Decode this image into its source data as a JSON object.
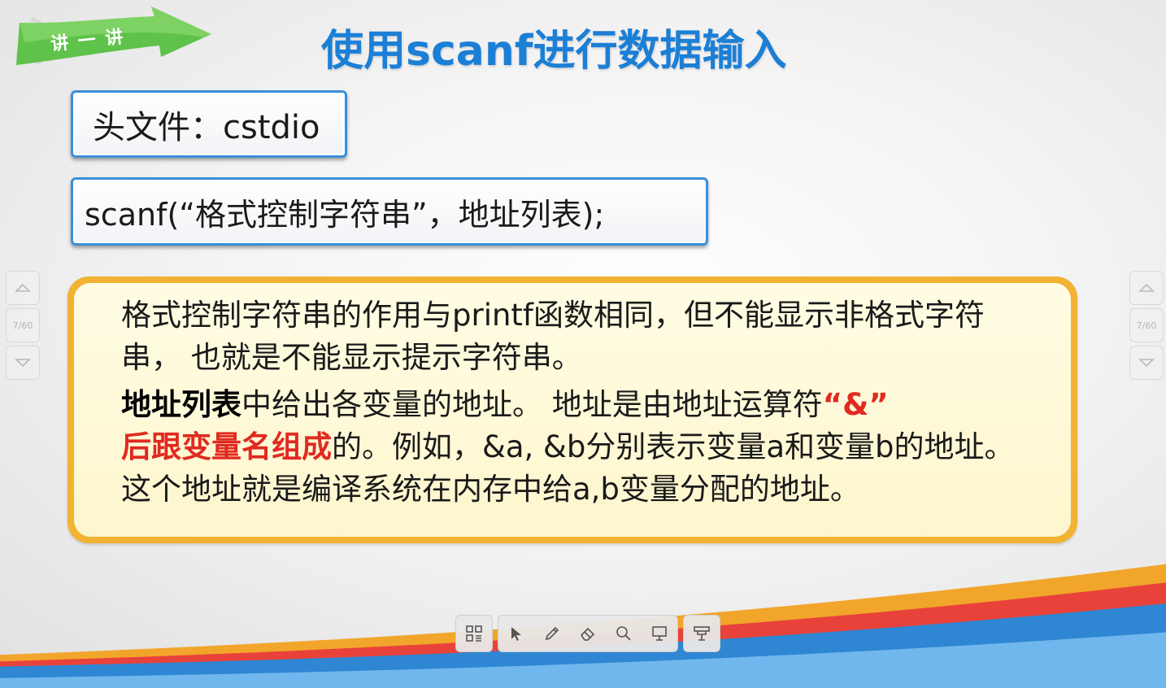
{
  "badge": {
    "text": "讲 一 讲"
  },
  "title": "使用scanf进行数据输入",
  "box1": {
    "text": "头文件：cstdio"
  },
  "box2": {
    "text": "scanf(“格式控制字符串”，地址列表);"
  },
  "notes": {
    "para1": "格式控制字符串的作用与printf函数相同，但不能显示非格式字符串， 也就是不能显示提示字符串。",
    "para2_bold": "地址列表",
    "para2_a": "中给出各变量的地址。 地址是由地址运算符",
    "para2_red_op": "“&”",
    "para2_red_b": "后跟变量名组成",
    "para2_b": "的。例如，&a, &b分别表示变量a和变量b的地址。这个地址就是编译系统在内存中给a,b变量分配的地址。"
  },
  "nav": {
    "page_indicator": "7/60"
  },
  "toolbar": {
    "items": [
      "grid-icon",
      "pointer-icon",
      "pen-icon",
      "eraser-icon",
      "zoom-icon",
      "whiteboard-icon",
      "blackboard-icon"
    ]
  },
  "colors": {
    "title_blue": "#1c7fd6",
    "box_border": "#3a8fd9",
    "note_border": "#f2b233",
    "note_bg": "#fffce4",
    "highlight_red": "#e02a20",
    "badge_green": "#5fc24a"
  }
}
